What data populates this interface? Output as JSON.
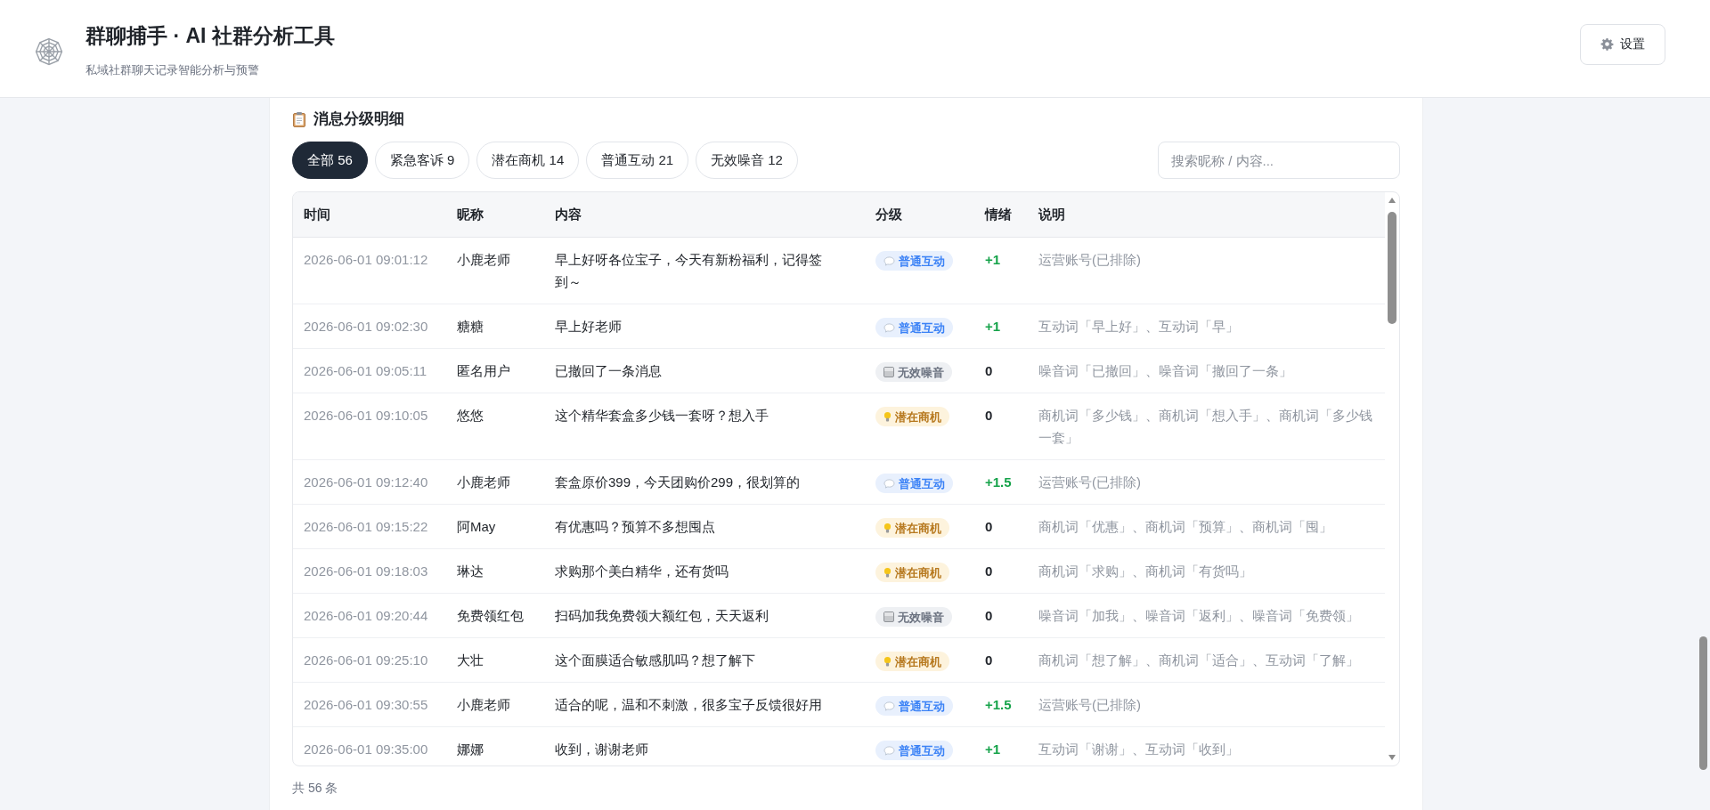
{
  "header": {
    "title": "群聊捕手 · AI 社群分析工具",
    "subtitle": "私域社群聊天记录智能分析与预警",
    "settings_button": "设置"
  },
  "section": {
    "title": "消息分级明细"
  },
  "filters": [
    {
      "label": "全部 56",
      "selected": true
    },
    {
      "label": "紧急客诉 9",
      "selected": false
    },
    {
      "label": "潜在商机 14",
      "selected": false
    },
    {
      "label": "普通互动 21",
      "selected": false
    },
    {
      "label": "无效噪音 12",
      "selected": false
    }
  ],
  "search": {
    "placeholder": "搜索昵称 / 内容..."
  },
  "table": {
    "columns": [
      "时间",
      "昵称",
      "内容",
      "分级",
      "情绪",
      "说明"
    ],
    "rows": [
      {
        "time": "2026-06-01 09:01:12",
        "nickname": "小鹿老师",
        "content": "早上好呀各位宝子，今天有新粉福利，记得签到～",
        "grade": "普通互动",
        "kind": "interaction",
        "emotion": "+1",
        "note": "运营账号(已排除)"
      },
      {
        "time": "2026-06-01 09:02:30",
        "nickname": "糖糖",
        "content": "早上好老师",
        "grade": "普通互动",
        "kind": "interaction",
        "emotion": "+1",
        "note": "互动词「早上好」、互动词「早」"
      },
      {
        "time": "2026-06-01 09:05:11",
        "nickname": "匿名用户",
        "content": "已撤回了一条消息",
        "grade": "无效噪音",
        "kind": "noise",
        "emotion": "0",
        "note": "噪音词「已撤回」、噪音词「撤回了一条」"
      },
      {
        "time": "2026-06-01 09:10:05",
        "nickname": "悠悠",
        "content": "这个精华套盒多少钱一套呀？想入手",
        "grade": "潜在商机",
        "kind": "opportunity",
        "emotion": "0",
        "note": "商机词「多少钱」、商机词「想入手」、商机词「多少钱一套」"
      },
      {
        "time": "2026-06-01 09:12:40",
        "nickname": "小鹿老师",
        "content": "套盒原价399，今天团购价299，很划算的",
        "grade": "普通互动",
        "kind": "interaction",
        "emotion": "+1.5",
        "note": "运营账号(已排除)"
      },
      {
        "time": "2026-06-01 09:15:22",
        "nickname": "阿May",
        "content": "有优惠吗？预算不多想囤点",
        "grade": "潜在商机",
        "kind": "opportunity",
        "emotion": "0",
        "note": "商机词「优惠」、商机词「预算」、商机词「囤」"
      },
      {
        "time": "2026-06-01 09:18:03",
        "nickname": "琳达",
        "content": "求购那个美白精华，还有货吗",
        "grade": "潜在商机",
        "kind": "opportunity",
        "emotion": "0",
        "note": "商机词「求购」、商机词「有货吗」"
      },
      {
        "time": "2026-06-01 09:20:44",
        "nickname": "免费领红包",
        "content": "扫码加我免费领大额红包，天天返利",
        "grade": "无效噪音",
        "kind": "noise",
        "emotion": "0",
        "note": "噪音词「加我」、噪音词「返利」、噪音词「免费领」"
      },
      {
        "time": "2026-06-01 09:25:10",
        "nickname": "大壮",
        "content": "这个面膜适合敏感肌吗？想了解下",
        "grade": "潜在商机",
        "kind": "opportunity",
        "emotion": "0",
        "note": "商机词「想了解」、商机词「适合」、互动词「了解」"
      },
      {
        "time": "2026-06-01 09:30:55",
        "nickname": "小鹿老师",
        "content": "适合的呢，温和不刺激，很多宝子反馈很好用",
        "grade": "普通互动",
        "kind": "interaction",
        "emotion": "+1.5",
        "note": "运营账号(已排除)"
      },
      {
        "time": "2026-06-01 09:35:00",
        "nickname": "娜娜",
        "content": "收到，谢谢老师",
        "grade": "普通互动",
        "kind": "interaction",
        "emotion": "+1",
        "note": "互动词「谢谢」、互动词「收到」"
      }
    ]
  },
  "footer": {
    "total": "共 56 条"
  }
}
